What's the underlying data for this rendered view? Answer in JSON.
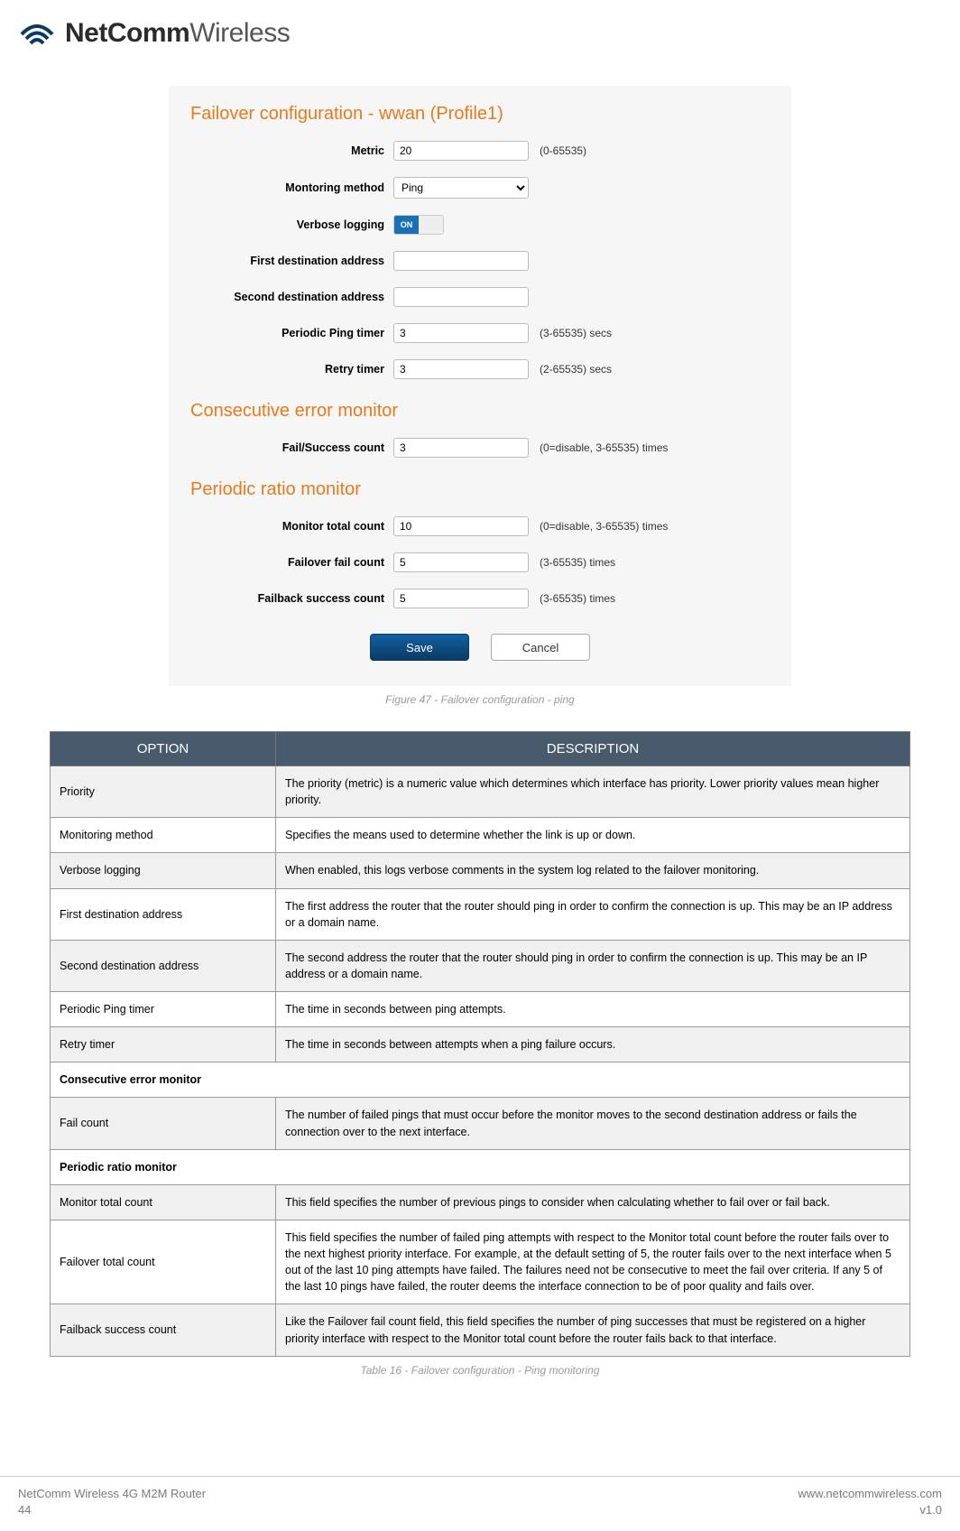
{
  "brand": {
    "bold": "NetComm",
    "light": "Wireless"
  },
  "config": {
    "title": "Failover configuration - wwan (Profile1)",
    "fields": {
      "metric": {
        "label": "Metric",
        "value": "20",
        "hint": "(0-65535)"
      },
      "monitoring": {
        "label": "Montoring method",
        "value": "Ping"
      },
      "verbose": {
        "label": "Verbose logging",
        "on": "ON",
        "off": ""
      },
      "first_dest": {
        "label": "First destination address",
        "value": ""
      },
      "second_dest": {
        "label": "Second destination address",
        "value": ""
      },
      "ping_timer": {
        "label": "Periodic Ping timer",
        "value": "3",
        "hint": "(3-65535) secs"
      },
      "retry_timer": {
        "label": "Retry timer",
        "value": "3",
        "hint": "(2-65535) secs"
      }
    },
    "cem_title": "Consecutive error monitor",
    "cem": {
      "fail_success": {
        "label": "Fail/Success count",
        "value": "3",
        "hint": "(0=disable, 3-65535) times"
      }
    },
    "prm_title": "Periodic ratio monitor",
    "prm": {
      "monitor_total": {
        "label": "Monitor total count",
        "value": "10",
        "hint": "(0=disable, 3-65535) times"
      },
      "failover_fail": {
        "label": "Failover fail count",
        "value": "5",
        "hint": "(3-65535) times"
      },
      "failback_success": {
        "label": "Failback success count",
        "value": "5",
        "hint": "(3-65535) times"
      }
    },
    "buttons": {
      "save": "Save",
      "cancel": "Cancel"
    }
  },
  "figure_caption": "Figure 47 - Failover configuration - ping",
  "table": {
    "headers": {
      "option": "OPTION",
      "description": "DESCRIPTION"
    },
    "rows": [
      {
        "opt": "Priority",
        "desc": "The priority (metric) is a numeric value which determines which interface has priority. Lower priority values mean higher priority."
      },
      {
        "opt": "Monitoring method",
        "desc": "Specifies the means used to determine whether the link is up or down."
      },
      {
        "opt": "Verbose logging",
        "desc": "When enabled, this logs verbose comments in the system log related to the failover monitoring."
      },
      {
        "opt": "First destination address",
        "desc": "The first address the router that the router should ping in order to confirm the connection is up. This may be an IP address or a domain name."
      },
      {
        "opt": "Second destination address",
        "desc": "The second address the router that the router should ping in order to confirm the connection is up. This may be an IP address or a domain name."
      },
      {
        "opt": "Periodic Ping timer",
        "desc": "The time in seconds between ping attempts."
      },
      {
        "opt": "Retry timer",
        "desc": "The time in seconds between attempts when a ping failure occurs."
      }
    ],
    "sub1": "Consecutive error monitor",
    "rows2": [
      {
        "opt": "Fail count",
        "desc": "The number of failed pings that must occur before the monitor moves to the second destination address or fails the connection over to the next interface."
      }
    ],
    "sub2": "Periodic ratio monitor",
    "rows3": [
      {
        "opt": "Monitor total count",
        "desc": "This field specifies the number of previous pings to consider when calculating whether to fail over or fail back."
      },
      {
        "opt": "Failover total count",
        "desc": "This field specifies the number of failed ping attempts with respect to the Monitor total count before the router fails over to the next highest priority interface. For example, at the default setting of 5, the router fails over to the next interface when 5 out of the last 10 ping attempts have failed. The failures need not be consecutive to meet the fail over criteria. If any 5 of the last 10 pings have failed, the router deems the interface connection to be of poor quality and fails over."
      },
      {
        "opt": "Failback success count",
        "desc": "Like the Failover fail count field, this field specifies the number of ping successes that must be registered on a higher priority interface with respect to the Monitor total count before the router fails back to that interface."
      }
    ]
  },
  "table_caption": "Table 16 - Failover configuration - Ping monitoring",
  "footer": {
    "product": "NetComm Wireless 4G M2M Router",
    "page": "44",
    "url": "www.netcommwireless.com",
    "version": "v1.0"
  }
}
